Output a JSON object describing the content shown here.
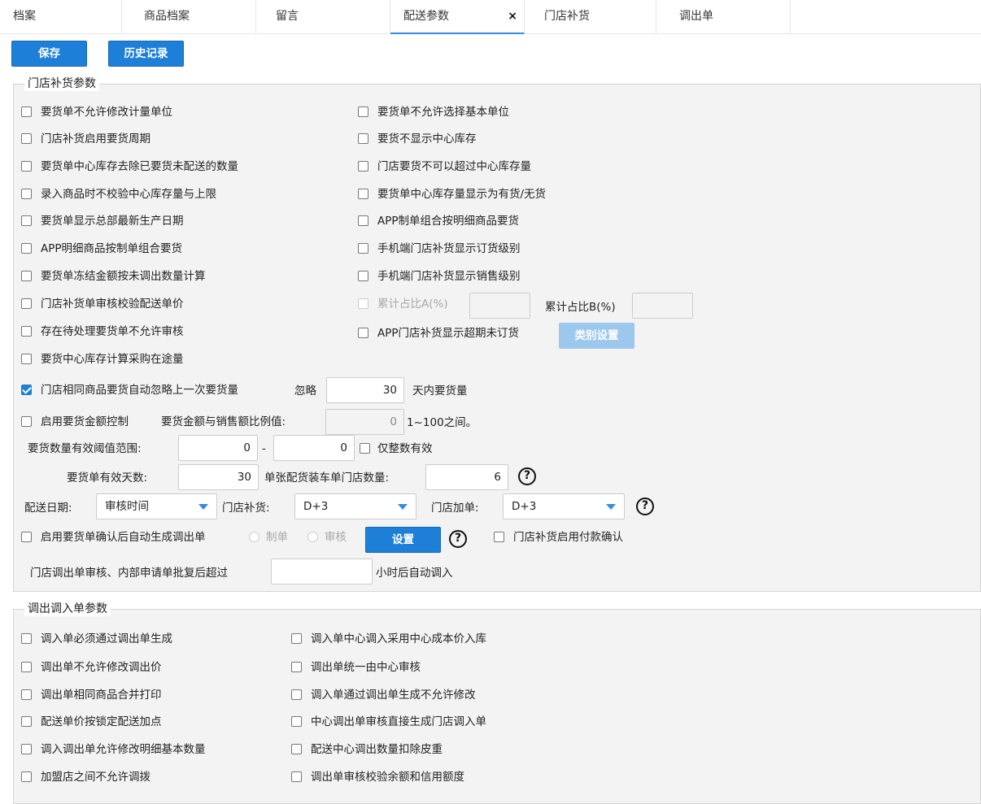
{
  "tabs": [
    {
      "label": "档案"
    },
    {
      "label": "商品档案"
    },
    {
      "label": "留言"
    },
    {
      "label": "配送参数"
    },
    {
      "label": "门店补货"
    },
    {
      "label": "调出单"
    }
  ],
  "tab_close": "×",
  "toolbar": {
    "save": "保存",
    "history": "历史记录"
  },
  "store_section": {
    "title": "门店补货参数",
    "left": [
      "要货单不允许修改计量单位",
      "门店补货启用要货周期",
      "要货单中心库存去除已要货未配送的数量",
      "录入商品时不校验中心库存量与上限",
      "要货单显示总部最新生产日期",
      "APP明细商品按制单组合要货",
      "要货单冻结金额按未调出数量计算",
      "门店补货单审核校验配送单价",
      "存在待处理要货单不允许审核",
      "要货中心库存计算采购在途量"
    ],
    "right": [
      "要货单不允许选择基本单位",
      "要货不显示中心库存",
      "门店要货不可以超过中心库存量",
      "要货单中心库存量显示为有货/无货",
      "APP制单组合按明细商品要货",
      "手机端门店补货显示订货级别",
      "手机端门店补货显示销售级别"
    ],
    "cumulative": {
      "a_label": "累计占比A(%)",
      "b_label": "累计占比B(%)",
      "a_value": "",
      "b_value": ""
    },
    "app_overdue": "APP门店补货显示超期未订货",
    "category_btn": "类别设置",
    "ignore": {
      "label": "门店相同商品要货自动忽略上一次要货量",
      "prefix": "忽略",
      "value": "30",
      "suffix": "天内要货量"
    },
    "amount_ctrl": {
      "label": "启用要货金额控制",
      "ratio_label": "要货金额与销售额比例值:",
      "value": "0",
      "hint": "1~100之间。"
    },
    "threshold": {
      "label": "要货数量有效阈值范围:",
      "from": "0",
      "sep": "-",
      "to": "0",
      "integer_only": "仅整数有效"
    },
    "valid_days": {
      "label": "要货单有效天数:",
      "value": "30",
      "truck_label": "单张配货装车单门店数量:",
      "truck_value": "6"
    },
    "delivery": {
      "date_label": "配送日期:",
      "date_value": "审核时间",
      "replenish_label": "门店补货:",
      "replenish_value": "D+3",
      "add_label": "门店加单:",
      "add_value": "D+3"
    },
    "auto_transfer": {
      "label": "启用要货单确认后自动生成调出单",
      "opt1": "制单",
      "opt2": "审核",
      "set_btn": "设置",
      "payment": "门店补货启用付款确认"
    },
    "auto_in": {
      "label": "门店调出单审核、内部申请单批复后超过",
      "value": "",
      "suffix": "小时后自动调入"
    }
  },
  "transfer_section": {
    "title": "调出调入单参数",
    "left": [
      "调入单必须通过调出单生成",
      "调出单不允许修改调出价",
      "调出单相同商品合并打印",
      "配送单价按锁定配送加点",
      "调入调出单允许修改明细基本数量",
      "加盟店之间不允许调拨"
    ],
    "right": [
      "调入单中心调入采用中心成本价入库",
      "调出单统一由中心审核",
      "调入单通过调出单生成不允许修改",
      "中心调出单审核直接生成门店调入单",
      "配送中心调出数量扣除皮重",
      "调出单审核校验余额和信用额度"
    ]
  },
  "help_icon": "?"
}
